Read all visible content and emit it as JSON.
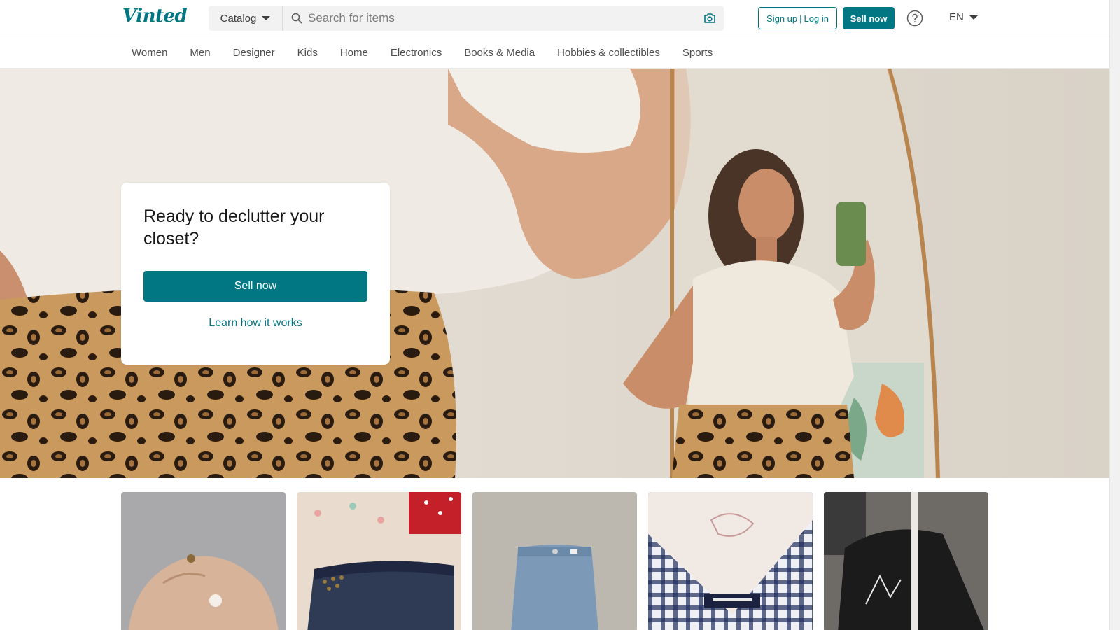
{
  "header": {
    "logo_text": "Vinted",
    "catalog_label": "Catalog",
    "search_placeholder": "Search for items",
    "signup_label": "Sign up",
    "login_label": "Log in",
    "separator": "|",
    "sell_label": "Sell now",
    "language": "EN",
    "icons": {
      "search": "search-icon",
      "camera": "camera-icon",
      "help": "help-icon",
      "caret": "chevron-down-icon"
    }
  },
  "nav": {
    "items": [
      {
        "label": "Women"
      },
      {
        "label": "Men"
      },
      {
        "label": "Designer"
      },
      {
        "label": "Kids"
      },
      {
        "label": "Home"
      },
      {
        "label": "Electronics"
      },
      {
        "label": "Books & Media"
      },
      {
        "label": "Hobbies & collectibles"
      },
      {
        "label": "Sports"
      }
    ]
  },
  "hero": {
    "title": "Ready to declutter your closet?",
    "cta_label": "Sell now",
    "link_label": "Learn how it works"
  },
  "items": [
    {
      "name": "item-cap"
    },
    {
      "name": "item-denim-shorts"
    },
    {
      "name": "item-jeans"
    },
    {
      "name": "item-plaid-top"
    },
    {
      "name": "item-black-hoodie"
    }
  ],
  "colors": {
    "brand": "#007782",
    "text": "#171717",
    "muted": "#4d4d4d"
  }
}
